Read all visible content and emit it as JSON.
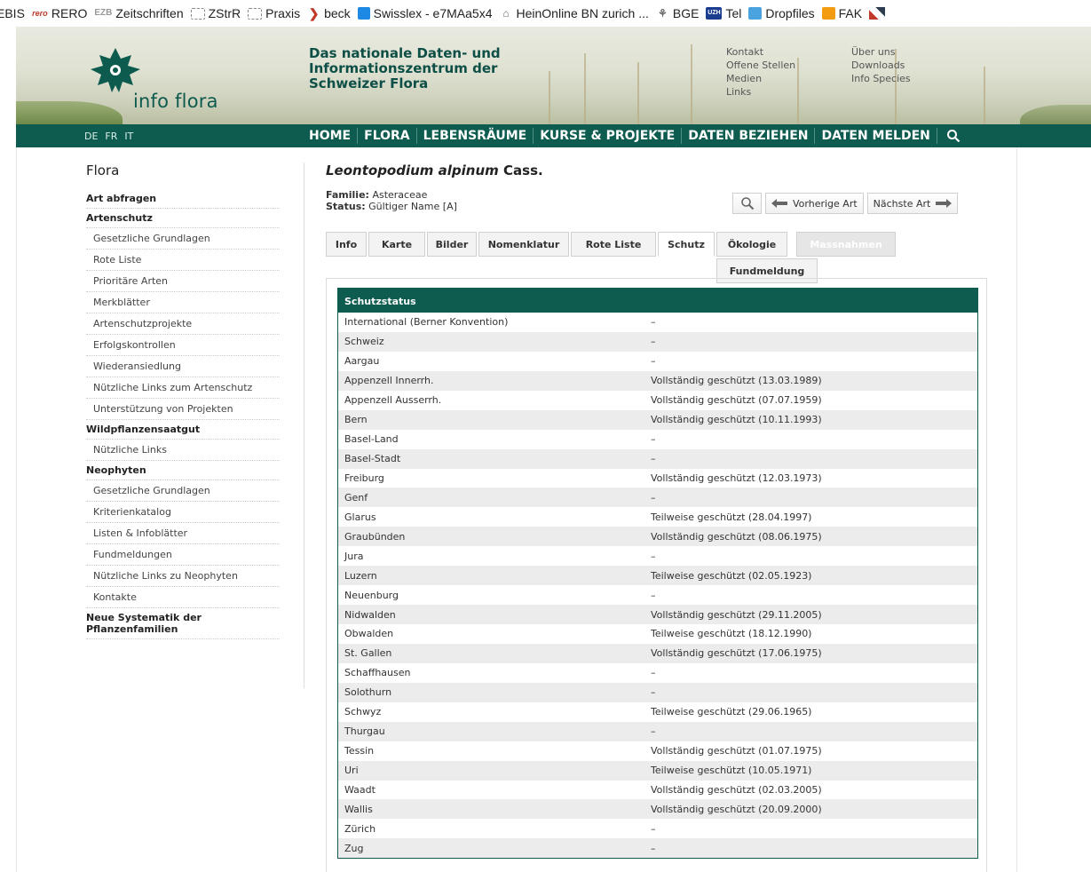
{
  "bookmarks": [
    {
      "label": "EBIS",
      "icon": "none"
    },
    {
      "label": "RERO",
      "icon": "rero-icon",
      "icon_text": "rero"
    },
    {
      "label": "Zeitschriften",
      "icon": "ez-icon",
      "icon_text": "EZB"
    },
    {
      "label": "ZStrR",
      "icon": "folder-icon"
    },
    {
      "label": "Praxis",
      "icon": "folder-icon"
    },
    {
      "label": "beck",
      "icon": "beck-icon"
    },
    {
      "label": "Swisslex - e7MAa5x4",
      "icon": "swisslex-icon"
    },
    {
      "label": "HeinOnline BN zurich ...",
      "icon": "heinonline-icon"
    },
    {
      "label": "BGE",
      "icon": "bge-icon"
    },
    {
      "label": "Tel",
      "icon": "uzh-icon",
      "icon_text": "UZH"
    },
    {
      "label": "Dropfiles",
      "icon": "dropfiles-icon"
    },
    {
      "label": "FAK",
      "icon": "fak-icon"
    }
  ],
  "header": {
    "logo_text": "info flora",
    "tagline": "Das nationale Daten- und Informationszentrum der Schweizer Flora",
    "links_col1": [
      "Kontakt",
      "Offene Stellen",
      "Medien",
      "Links"
    ],
    "links_col2": [
      "Über uns",
      "Downloads",
      "Info Species"
    ]
  },
  "nav": {
    "languages": [
      "DE",
      "FR",
      "IT"
    ],
    "items": [
      "HOME",
      "FLORA",
      "LEBENSRÄUME",
      "KURSE & PROJEKTE",
      "DATEN BEZIEHEN",
      "DATEN MELDEN"
    ]
  },
  "sidebar": {
    "title": "Flora",
    "items": [
      {
        "label": "Art abfragen",
        "level": "section"
      },
      {
        "label": "Artenschutz",
        "level": "section"
      },
      {
        "label": "Gesetzliche Grundlagen",
        "level": "sub"
      },
      {
        "label": "Rote Liste",
        "level": "sub"
      },
      {
        "label": "Prioritäre Arten",
        "level": "sub"
      },
      {
        "label": "Merkblätter",
        "level": "sub"
      },
      {
        "label": "Artenschutzprojekte",
        "level": "sub"
      },
      {
        "label": "Erfolgskontrollen",
        "level": "sub"
      },
      {
        "label": "Wiederansiedlung",
        "level": "sub"
      },
      {
        "label": "Nützliche Links zum Artenschutz",
        "level": "sub"
      },
      {
        "label": "Unterstützung von Projekten",
        "level": "sub"
      },
      {
        "label": "Wildpflanzensaatgut",
        "level": "section"
      },
      {
        "label": "Nützliche Links",
        "level": "sub"
      },
      {
        "label": "Neophyten",
        "level": "section"
      },
      {
        "label": "Gesetzliche Grundlagen",
        "level": "sub"
      },
      {
        "label": "Kriterienkatalog",
        "level": "sub"
      },
      {
        "label": "Listen & Infoblätter",
        "level": "sub"
      },
      {
        "label": "Fundmeldungen",
        "level": "sub"
      },
      {
        "label": "Nützliche Links zu Neophyten",
        "level": "sub"
      },
      {
        "label": "Kontakte",
        "level": "sub"
      },
      {
        "label": "Neue Systematik der Pflanzenfamilien",
        "level": "section"
      }
    ]
  },
  "species": {
    "name_italic": "Leontopodium alpinum",
    "author": "Cass.",
    "familie_label": "Familie:",
    "familie": "Asteraceae",
    "status_label": "Status:",
    "status": "Gültiger Name [A]"
  },
  "buttons": {
    "prev": "Vorherige Art",
    "next": "Nächste Art"
  },
  "tabs": [
    {
      "label": "Info",
      "state": "normal"
    },
    {
      "label": "Karte",
      "state": "normal"
    },
    {
      "label": "Bilder",
      "state": "normal"
    },
    {
      "label": "Nomenklatur",
      "state": "normal"
    },
    {
      "label": "Rote Liste",
      "state": "normal"
    },
    {
      "label": "Schutz",
      "state": "active"
    },
    {
      "label": "Ökologie",
      "state": "normal"
    },
    {
      "label": "Massnahmen",
      "state": "disabled"
    },
    {
      "label": "Fundmeldung",
      "state": "normal"
    }
  ],
  "table": {
    "header": "Schutzstatus",
    "rows": [
      [
        "International (Berner Konvention)",
        "–"
      ],
      [
        "Schweiz",
        "–"
      ],
      [
        "Aargau",
        "–"
      ],
      [
        "Appenzell Innerrh.",
        "Vollständig geschützt (13.03.1989)"
      ],
      [
        "Appenzell Ausserrh.",
        "Vollständig geschützt (07.07.1959)"
      ],
      [
        "Bern",
        "Vollständig geschützt (10.11.1993)"
      ],
      [
        "Basel-Land",
        "–"
      ],
      [
        "Basel-Stadt",
        "–"
      ],
      [
        "Freiburg",
        "Vollständig geschützt (12.03.1973)"
      ],
      [
        "Genf",
        "–"
      ],
      [
        "Glarus",
        "Teilweise geschützt (28.04.1997)"
      ],
      [
        "Graubünden",
        "Vollständig geschützt (08.06.1975)"
      ],
      [
        "Jura",
        "–"
      ],
      [
        "Luzern",
        "Teilweise geschützt (02.05.1923)"
      ],
      [
        "Neuenburg",
        "–"
      ],
      [
        "Nidwalden",
        "Vollständig geschützt (29.11.2005)"
      ],
      [
        "Obwalden",
        "Teilweise geschützt (18.12.1990)"
      ],
      [
        "St. Gallen",
        "Vollständig geschützt (17.06.1975)"
      ],
      [
        "Schaffhausen",
        "–"
      ],
      [
        "Solothurn",
        "–"
      ],
      [
        "Schwyz",
        "Teilweise geschützt (29.06.1965)"
      ],
      [
        "Thurgau",
        "–"
      ],
      [
        "Tessin",
        "Vollständig geschützt (01.07.1975)"
      ],
      [
        "Uri",
        "Teilweise geschützt (10.05.1971)"
      ],
      [
        "Waadt",
        "Vollständig geschützt (02.03.2005)"
      ],
      [
        "Wallis",
        "Vollständig geschützt (20.09.2000)"
      ],
      [
        "Zürich",
        "–"
      ],
      [
        "Zug",
        "–"
      ]
    ]
  },
  "colors": {
    "brand_green": "#0e5c50",
    "header_bg": "#dfe1d2"
  }
}
